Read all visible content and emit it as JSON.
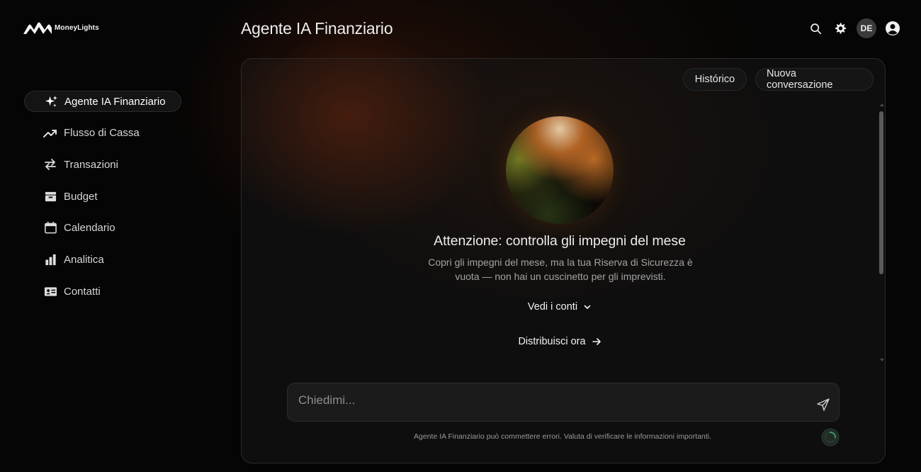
{
  "app": {
    "brand_name": "MoneyLights",
    "page_title": "Agente IA Finanziario"
  },
  "sidebar": {
    "items": [
      {
        "label": "Agente IA Finanziario",
        "icon": "sparkles-icon",
        "active": true
      },
      {
        "label": "Flusso di Cassa",
        "icon": "trending-up-icon",
        "active": false
      },
      {
        "label": "Transazioni",
        "icon": "swap-arrows-icon",
        "active": false
      },
      {
        "label": "Budget",
        "icon": "wallet-icon",
        "active": false
      },
      {
        "label": "Calendario",
        "icon": "calendar-icon",
        "active": false
      },
      {
        "label": "Analitica",
        "icon": "bar-chart-icon",
        "active": false
      },
      {
        "label": "Contatti",
        "icon": "contact-card-icon",
        "active": false
      }
    ]
  },
  "header": {
    "avatar_initials": "DE",
    "icons": [
      "search-icon",
      "gear-icon",
      "user-circle-icon"
    ]
  },
  "panel": {
    "history_label": "Histórico",
    "new_conversation_label": "Nuova conversazione",
    "headline": "Attenzione: controlla gli impegni del mese",
    "subtext": "Copri gli impegni del mese, ma la tua Riserva di Sicurezza è vuota — non hai un cuscinetto per gli imprevisti.",
    "accounts_link": "Vedi i conti",
    "distribute_link": "Distribuisci ora"
  },
  "chat": {
    "placeholder": "Chiedimi...",
    "disclaimer": "Agente IA Finanziario può commettere errori. Valuta di verificare le informazioni importanti."
  },
  "colors": {
    "background": "#050505",
    "panel": "#0e0e0e",
    "accent_glow": "#7a2e10"
  }
}
